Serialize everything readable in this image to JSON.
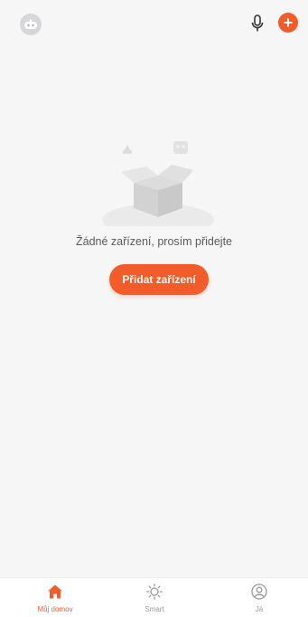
{
  "header": {
    "avatar_icon": "robot-avatar-icon",
    "mic_icon": "microphone-icon",
    "add_icon": "plus-icon"
  },
  "empty_state": {
    "message": "Žádné zařízení, prosím přidejte",
    "add_button_label": "Přidat zařízení",
    "illustration_icon": "open-box-icon"
  },
  "bottom_nav": {
    "items": [
      {
        "label": "Můj domov",
        "icon": "home-icon",
        "active": true
      },
      {
        "label": "Smart",
        "icon": "sun-icon",
        "active": false
      },
      {
        "label": "Já",
        "icon": "profile-icon",
        "active": false
      }
    ]
  },
  "colors": {
    "accent": "#f25c2a",
    "background": "#f6f6f6",
    "nav_inactive": "#9a9a9a"
  }
}
